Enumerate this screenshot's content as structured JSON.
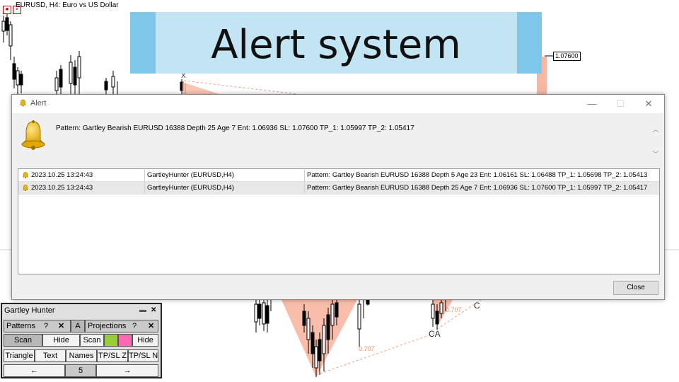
{
  "chart": {
    "title": "EURUSD, H4:  Euro vs US Dollar",
    "price_label": "1.07600",
    "pattern_labels": {
      "x": "X",
      "c": "C",
      "ca": "CA"
    },
    "ratio_labels": [
      "0.707",
      "0.707"
    ],
    "colors": {
      "candle": "#000000",
      "pattern_fill": "#f7b6a2",
      "pattern_line": "#f0a080"
    }
  },
  "banner": {
    "text": "Alert system",
    "color": "#c3e4f3",
    "edge_color": "#7ec7ea"
  },
  "alert": {
    "title": "Alert",
    "message": "Pattern: Gartley Bearish EURUSD 16388 Depth 25 Age 7 Ent: 1.06936 SL: 1.07600 TP_1: 1.05997 TP_2: 1.05417",
    "rows": [
      {
        "time": "2023.10.25 13:24:43",
        "source": "GartleyHunter (EURUSD,H4)",
        "message": "Pattern: Gartley Bearish EURUSD 16388 Depth 5 Age 23 Ent: 1.06161 SL: 1.06488 TP_1: 1.05698 TP_2: 1.05413"
      },
      {
        "time": "2023.10.25 13:24:43",
        "source": "GartleyHunter (EURUSD,H4)",
        "message": "Pattern: Gartley Bearish EURUSD 16388 Depth 25 Age 7 Ent: 1.06936 SL: 1.07600 TP_1: 1.05997 TP_2: 1.05417"
      }
    ],
    "close_label": "Close"
  },
  "panel": {
    "title": "Gartley Hunter",
    "patterns_label": "Patterns",
    "a_label": "A",
    "projections_label": "Projections",
    "scan_label": "Scan",
    "hide_label": "Hide",
    "scan2_label": "Scan",
    "hide2_label": "Hide",
    "triangle_label": "Triangle",
    "text_label": "Text",
    "names_label": "Names",
    "tpsl_z_label": "TP/SL Z",
    "tpsl_n_label": "TP/SL N",
    "prev_label": "←",
    "page_value": "5",
    "next_label": "→",
    "colors": {
      "green": "#9acd32",
      "pink": "#ff69b4"
    }
  }
}
